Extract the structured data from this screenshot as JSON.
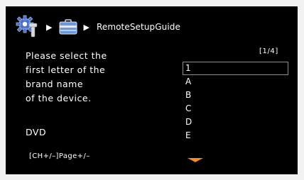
{
  "breadcrumb": {
    "icons": [
      "gear-icon",
      "toolbox-icon"
    ],
    "separator": "▶",
    "label": "RemoteSetupGuide"
  },
  "instructions": {
    "lines": [
      "Please select the",
      "first letter of the",
      "brand name",
      "of the device."
    ]
  },
  "device_type": "DVD",
  "hint": "[CH+/–]Page+/–",
  "page_indicator": "[1/4]",
  "letters": {
    "items": [
      "1",
      "A",
      "B",
      "C",
      "D",
      "E"
    ],
    "selected_index": 0
  },
  "colors": {
    "screen_bg": "#000000",
    "highlight": "#e07a1f",
    "text": "#ffffff",
    "gear": "#4b6fc4"
  }
}
